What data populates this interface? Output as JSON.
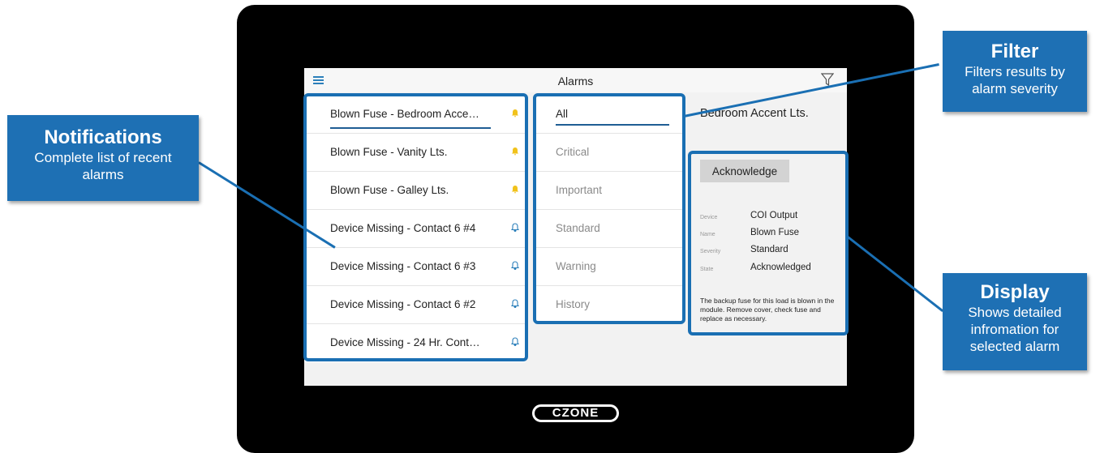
{
  "header": {
    "title": "Alarms"
  },
  "notifications": [
    {
      "label": "Blown Fuse - Bedroom Accen...",
      "severity_color": "#f1c21b"
    },
    {
      "label": "Blown Fuse - Vanity Lts.",
      "severity_color": "#f1c21b"
    },
    {
      "label": "Blown Fuse - Galley Lts.",
      "severity_color": "#f1c21b"
    },
    {
      "label": "Device Missing - Contact 6 #4",
      "severity_color": "#2b7fba"
    },
    {
      "label": "Device Missing - Contact 6 #3",
      "severity_color": "#2b7fba"
    },
    {
      "label": "Device Missing - Contact 6 #2",
      "severity_color": "#2b7fba"
    },
    {
      "label": "Device Missing - 24 Hr. Conta...",
      "severity_color": "#2b7fba"
    }
  ],
  "filters": [
    {
      "label": "All",
      "selected": true
    },
    {
      "label": "Critical",
      "selected": false
    },
    {
      "label": "Important",
      "selected": false
    },
    {
      "label": "Standard",
      "selected": false
    },
    {
      "label": "Warning",
      "selected": false
    },
    {
      "label": "History",
      "selected": false
    }
  ],
  "detail": {
    "title": "Bedroom Accent Lts.",
    "acknowledge_label": "Acknowledge",
    "fields": [
      {
        "label": "Device",
        "value": "COI Output"
      },
      {
        "label": "Name",
        "value": "Blown Fuse"
      },
      {
        "label": "Severity",
        "value": "Standard"
      },
      {
        "label": "State",
        "value": "Acknowledged"
      }
    ],
    "description": "The backup fuse for this load is blown in the module. Remove cover, check fuse and replace as necessary."
  },
  "callouts": {
    "notifications": {
      "heading": "Notifications",
      "body": "Complete list of recent alarms"
    },
    "filter": {
      "heading": "Filter",
      "body": "Filters results by alarm severity"
    },
    "display": {
      "heading": "Display",
      "body": "Shows detailed infromation for selected alarm"
    }
  },
  "logo": {
    "text": "CZONE"
  },
  "colors": {
    "accent": "#1e70b4",
    "highlight": "#1a6fb3",
    "warning_bell": "#f1c21b",
    "info_bell": "#2b7fba"
  }
}
